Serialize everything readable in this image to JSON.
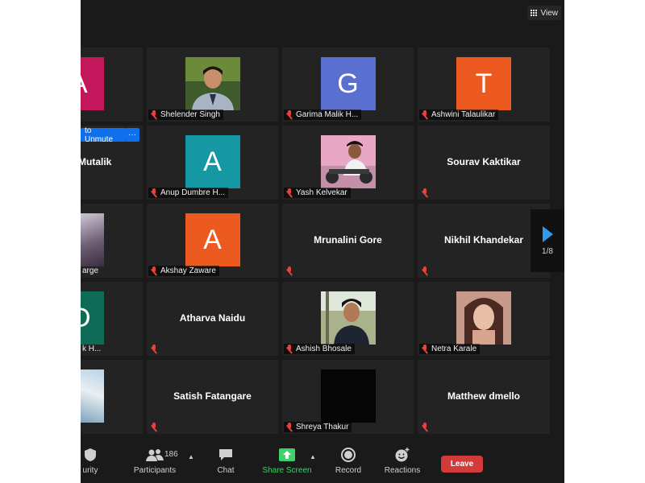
{
  "view": {
    "label": "View"
  },
  "partial_tiles": {
    "row1_letter": "A",
    "row2_mutalik": "Mutalik",
    "row2_unmute": "to Unmute",
    "row2_more": "···",
    "row3_label": "arge",
    "row4_letter": "D",
    "row4_label": "k H..."
  },
  "tiles": [
    {
      "name": "Shelender Singh",
      "kind": "photo"
    },
    {
      "name": "Garima Malik H...",
      "kind": "letter",
      "letter": "G",
      "color": "#5b6fd1"
    },
    {
      "name": "Ashwini Talaulikar",
      "kind": "letter",
      "letter": "T",
      "color": "#ec5a1f"
    },
    {
      "name": "Anup Dumbre H...",
      "kind": "letter",
      "letter": "A",
      "color": "#1597a4"
    },
    {
      "name": "Yash Kelvekar",
      "kind": "photo"
    },
    {
      "name": "Sourav Kaktikar",
      "kind": "name"
    },
    {
      "name": "Akshay Zaware",
      "kind": "letter",
      "letter": "A",
      "color": "#ec5a1f"
    },
    {
      "name": "Mrunalini Gore",
      "kind": "name"
    },
    {
      "name": "Nikhil Khandekar",
      "kind": "name"
    },
    {
      "name": "Atharva Naidu",
      "kind": "name"
    },
    {
      "name": "Ashish Bhosale",
      "kind": "photo"
    },
    {
      "name": "Netra Karale",
      "kind": "photo"
    },
    {
      "name": "Satish Fatangare",
      "kind": "name"
    },
    {
      "name": "Shreya Thakur",
      "kind": "photo"
    },
    {
      "name": "Matthew dmello",
      "kind": "name"
    }
  ],
  "pagination": {
    "indicator": "1/8"
  },
  "toolbar": {
    "security_label": "urity",
    "participants_label": "Participants",
    "participants_count": "186",
    "chat_label": "Chat",
    "share_label": "Share Screen",
    "record_label": "Record",
    "reactions_label": "Reactions",
    "leave_label": "Leave"
  },
  "colors": {
    "accent_blue": "#0e71eb",
    "share_green": "#3fd16b",
    "leave_red": "#d33a3a",
    "muted_red": "#e8423d"
  }
}
